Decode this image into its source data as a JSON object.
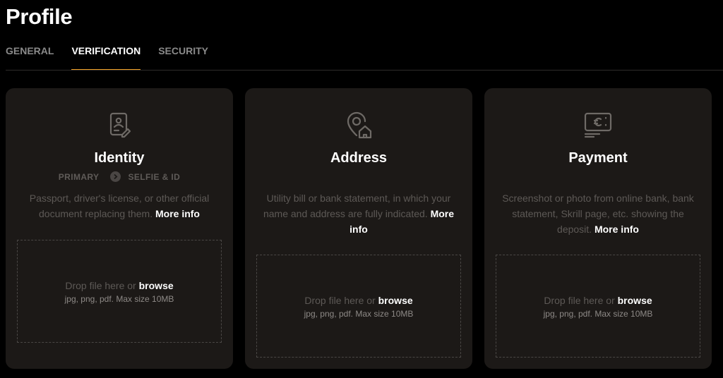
{
  "page": {
    "title": "Profile"
  },
  "tabs": [
    {
      "label": "GENERAL",
      "active": false
    },
    {
      "label": "VERIFICATION",
      "active": true
    },
    {
      "label": "SECURITY",
      "active": false
    }
  ],
  "colors": {
    "accent": "#f0a024",
    "card_bg": "#1c1917",
    "page_bg": "#000000"
  },
  "cards": [
    {
      "icon": "id-badge-icon",
      "title": "Identity",
      "steps": {
        "primary": "PRIMARY",
        "secondary": "SELFIE & ID"
      },
      "description": "Passport, driver's license, or other official document replacing them.",
      "more_info": "More info",
      "drop": {
        "text": "Drop file here or",
        "browse": "browse",
        "hint": "jpg, png, pdf. Max size 10MB"
      }
    },
    {
      "icon": "location-home-icon",
      "title": "Address",
      "description": "Utility bill or bank statement, in which your name and address are fully indicated.",
      "more_info": "More info",
      "drop": {
        "text": "Drop file here or",
        "browse": "browse",
        "hint": "jpg, png, pdf. Max size 10MB"
      }
    },
    {
      "icon": "payment-card-icon",
      "title": "Payment",
      "description": "Screenshot or photo from online bank, bank statement, Skrill page, etc. showing the deposit.",
      "more_info": "More info",
      "drop": {
        "text": "Drop file here or",
        "browse": "browse",
        "hint": "jpg, png, pdf. Max size 10MB"
      }
    }
  ]
}
